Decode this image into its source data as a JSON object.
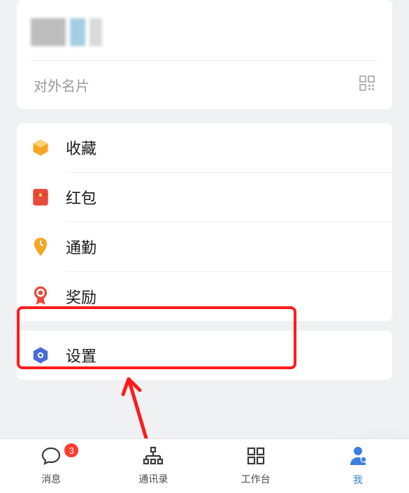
{
  "profile": {
    "external_card_label": "对外名片"
  },
  "menu": [
    {
      "label": "收藏",
      "icon": "box-icon",
      "color": "#f5a623"
    },
    {
      "label": "红包",
      "icon": "red-packet-icon",
      "color": "#e84a3a"
    },
    {
      "label": "通勤",
      "icon": "commute-icon",
      "color": "#f5a623"
    },
    {
      "label": "奖励",
      "icon": "award-icon",
      "color": "#e84a3a"
    }
  ],
  "settings": {
    "label": "设置",
    "icon": "gear-icon",
    "color": "#4a6bd6"
  },
  "tabs": [
    {
      "label": "消息",
      "icon": "chat-icon",
      "badge": "3",
      "active": false
    },
    {
      "label": "通讯录",
      "icon": "contacts-icon",
      "badge": null,
      "active": false
    },
    {
      "label": "工作台",
      "icon": "workbench-icon",
      "badge": null,
      "active": false
    },
    {
      "label": "我",
      "icon": "profile-icon",
      "badge": null,
      "active": true
    }
  ],
  "annotation": {
    "type": "highlight",
    "target": "settings-row"
  }
}
